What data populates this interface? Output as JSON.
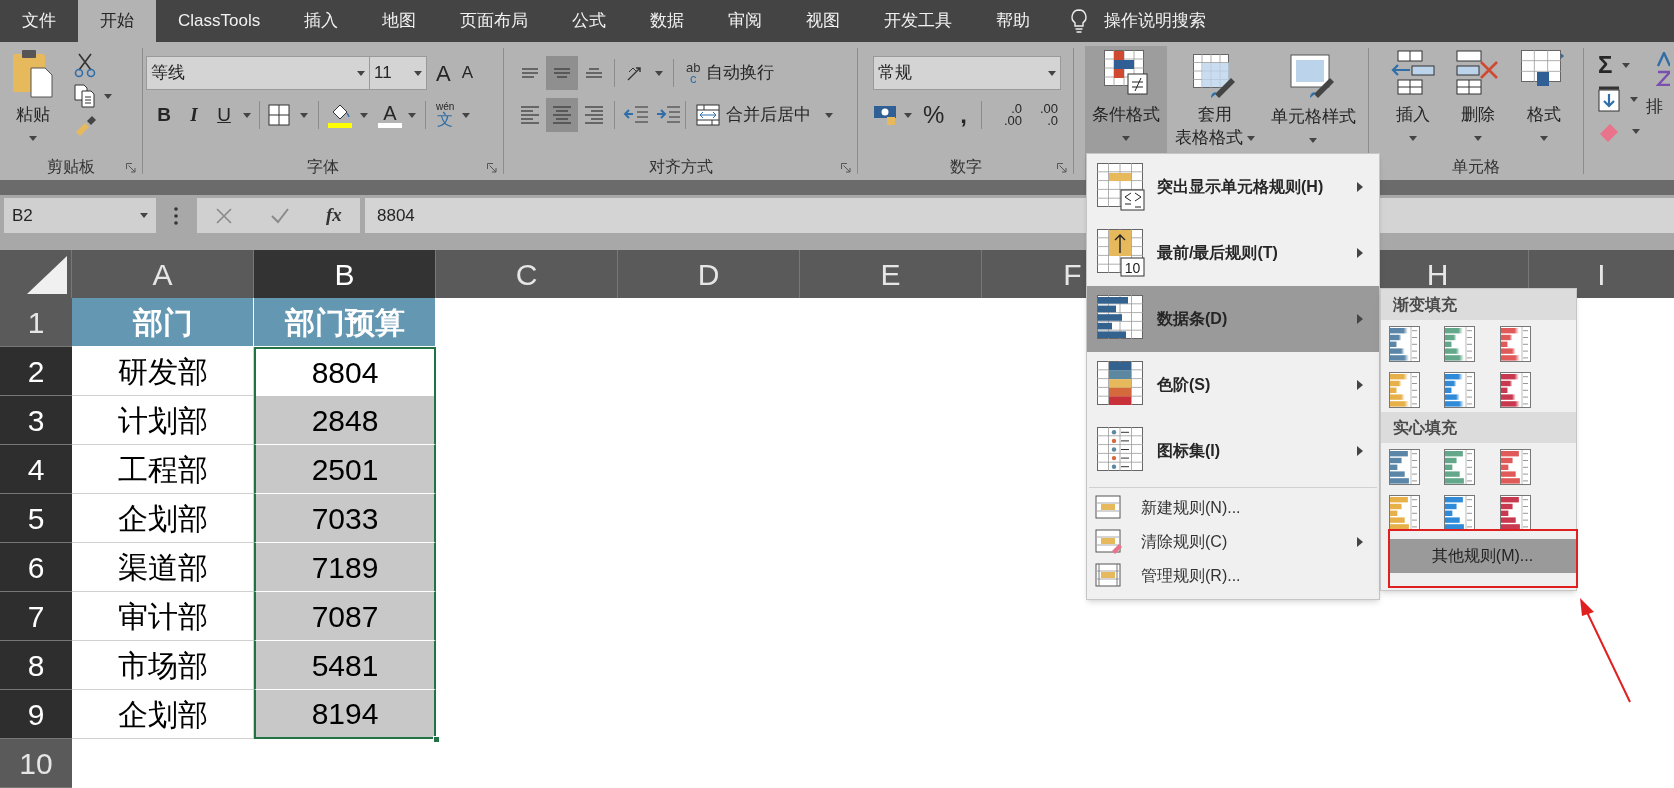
{
  "tabs": [
    {
      "label": "文件",
      "selected": false
    },
    {
      "label": "开始",
      "selected": true
    },
    {
      "label": "ClassTools",
      "selected": false
    },
    {
      "label": "插入",
      "selected": false
    },
    {
      "label": "地图",
      "selected": false
    },
    {
      "label": "页面布局",
      "selected": false
    },
    {
      "label": "公式",
      "selected": false
    },
    {
      "label": "数据",
      "selected": false
    },
    {
      "label": "审阅",
      "selected": false
    },
    {
      "label": "视图",
      "selected": false
    },
    {
      "label": "开发工具",
      "selected": false
    },
    {
      "label": "帮助",
      "selected": false
    }
  ],
  "tell_me": "操作说明搜索",
  "clipboard": {
    "paste": "粘贴",
    "label": "剪贴板"
  },
  "font": {
    "name": "等线",
    "size": "11",
    "grow": "A",
    "shrink": "A",
    "bold": "B",
    "italic": "I",
    "underline": "U",
    "font_color": "A",
    "phonetic_top": "wén",
    "phonetic_bottom": "文",
    "label": "字体"
  },
  "alignment": {
    "vertical": [
      {
        "kind": "top",
        "selected": false
      },
      {
        "kind": "middle",
        "selected": true
      },
      {
        "kind": "bottom",
        "selected": false
      }
    ],
    "horizontal": [
      {
        "kind": "left",
        "selected": false
      },
      {
        "kind": "center",
        "selected": true
      },
      {
        "kind": "right",
        "selected": false
      }
    ],
    "wrap_glyph_top": "ab",
    "wrap_glyph_bottom": "c",
    "wrap_text": "自动换行",
    "merge": "合并后居中",
    "label": "对齐方式"
  },
  "number": {
    "format": "常规",
    "percent": "%",
    "comma": ",",
    "decimals": [
      {
        "top": ".0",
        "bottom": ".00"
      },
      {
        "top": ".00",
        "bottom": ".0"
      }
    ],
    "label": "数字"
  },
  "styles": {
    "conditional": "条件格式",
    "conditional_pressed": true,
    "table_top": "套用",
    "table_bottom": "表格格式",
    "cell_styles": "单元格样式"
  },
  "cells": {
    "insert": "插入",
    "delete": "删除",
    "format": "格式",
    "label": "单元格"
  },
  "editing": {
    "sigma": "Σ",
    "sort": "排"
  },
  "formula_bar": {
    "name_box": "B2",
    "fx": "fx",
    "value": "8804"
  },
  "columns_left": [
    {
      "label": "A",
      "selected": false
    },
    {
      "label": "B",
      "selected": true
    },
    {
      "label": "C",
      "selected": false
    },
    {
      "label": "D",
      "selected": false
    },
    {
      "label": "E",
      "selected": false
    },
    {
      "label": "F",
      "selected": false
    }
  ],
  "columns_right": [
    {
      "label": "H",
      "selected": false
    },
    {
      "label": "I",
      "selected": false
    }
  ],
  "rows": [
    {
      "number": "1",
      "kind": "header",
      "selected": false,
      "cells": [
        "部门",
        "部门预算"
      ]
    },
    {
      "number": "2",
      "kind": "data",
      "selected": true,
      "cells": [
        "研发部",
        "8804"
      ]
    },
    {
      "number": "3",
      "kind": "data",
      "selected": true,
      "cells": [
        "计划部",
        "2848"
      ]
    },
    {
      "number": "4",
      "kind": "data",
      "selected": true,
      "cells": [
        "工程部",
        "2501"
      ]
    },
    {
      "number": "5",
      "kind": "data",
      "selected": true,
      "cells": [
        "企划部",
        "7033"
      ]
    },
    {
      "number": "6",
      "kind": "data",
      "selected": true,
      "cells": [
        "渠道部",
        "7189"
      ]
    },
    {
      "number": "7",
      "kind": "data",
      "selected": true,
      "cells": [
        "审计部",
        "7087"
      ]
    },
    {
      "number": "8",
      "kind": "data",
      "selected": true,
      "cells": [
        "市场部",
        "5481"
      ]
    },
    {
      "number": "9",
      "kind": "data",
      "selected": true,
      "cells": [
        "企划部",
        "8194"
      ]
    },
    {
      "number": "10",
      "kind": "empty",
      "selected": false
    }
  ],
  "menu": {
    "items": [
      {
        "kind": "highlight",
        "label": "突出显示单元格规则(H)",
        "submenu": true,
        "selected": false
      },
      {
        "kind": "top_bottom",
        "badge": "10",
        "label": "最前/最后规则(T)",
        "submenu": true,
        "selected": false
      },
      {
        "kind": "data_bars",
        "label": "数据条(D)",
        "submenu": true,
        "selected": true
      },
      {
        "kind": "color_scale",
        "label": "色阶(S)",
        "submenu": true,
        "selected": false
      },
      {
        "kind": "icon_set",
        "label": "图标集(I)",
        "submenu": true,
        "selected": false
      },
      {
        "kind": "new_rule",
        "label": "新建规则(N)...",
        "submenu": false,
        "selected": false
      },
      {
        "kind": "clear_rule",
        "label": "清除规则(C)",
        "submenu": true,
        "selected": false
      },
      {
        "kind": "manage_rule",
        "label": "管理规则(R)...",
        "submenu": false,
        "selected": false
      }
    ]
  },
  "submenu": {
    "sections": [
      {
        "title": "渐变填充",
        "kind": "gradient",
        "swatches": [
          {
            "color": "#5b86a8"
          },
          {
            "color": "#63a88a"
          },
          {
            "color": "#e05a5a"
          },
          {
            "color": "#e8b048"
          },
          {
            "color": "#2f8ad8"
          },
          {
            "color": "#c8384e"
          }
        ]
      },
      {
        "title": "实心填充",
        "kind": "solid",
        "swatches": [
          {
            "color": "#5b86a8"
          },
          {
            "color": "#63a88a"
          },
          {
            "color": "#e05a5a"
          },
          {
            "color": "#e8b048"
          },
          {
            "color": "#2f8ad8"
          },
          {
            "color": "#c8384e"
          }
        ]
      }
    ],
    "more": "其他规则(M)..."
  }
}
